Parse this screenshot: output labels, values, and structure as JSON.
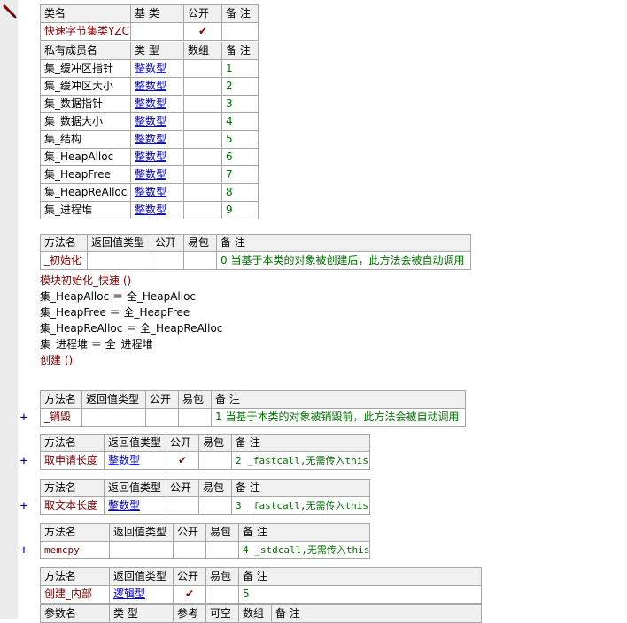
{
  "class_table": {
    "headers": [
      "类名",
      "基 类",
      "公开",
      "备 注"
    ],
    "name": "快速字节集类YZC",
    "base": "",
    "public": "✔",
    "note": ""
  },
  "members_table": {
    "headers": [
      "私有成员名",
      "类 型",
      "数组",
      "备 注"
    ],
    "rows": [
      {
        "name": "集_缓冲区指针",
        "type": "整数型",
        "array": "",
        "note": "1"
      },
      {
        "name": "集_缓冲区大小",
        "type": "整数型",
        "array": "",
        "note": "2"
      },
      {
        "name": "集_数据指针",
        "type": "整数型",
        "array": "",
        "note": "3"
      },
      {
        "name": "集_数据大小",
        "type": "整数型",
        "array": "",
        "note": "4"
      },
      {
        "name": "集_结构",
        "type": "整数型",
        "array": "",
        "note": "5"
      },
      {
        "name": "集_HeapAlloc",
        "type": "整数型",
        "array": "",
        "note": "6"
      },
      {
        "name": "集_HeapFree",
        "type": "整数型",
        "array": "",
        "note": "7"
      },
      {
        "name": "集_HeapReAlloc",
        "type": "整数型",
        "array": "",
        "note": "8"
      },
      {
        "name": "集_进程堆",
        "type": "整数型",
        "array": "",
        "note": "9"
      }
    ]
  },
  "method_headers": [
    "方法名",
    "返回值类型",
    "公开",
    "易包",
    "备 注"
  ],
  "methods": [
    {
      "name": "_初始化",
      "ret": "",
      "public": "",
      "easy": "",
      "note": "0 当基于本类的对象被创建后，此方法会被自动调用"
    },
    {
      "name": "_销毁",
      "ret": "",
      "public": "",
      "easy": "",
      "note": "1 当基于本类的对象被销毁前，此方法会被自动调用"
    },
    {
      "name": "取申请长度",
      "ret": "整数型",
      "public": "✔",
      "easy": "",
      "note": "2 _fastcall,无需传入this"
    },
    {
      "name": "取文本长度",
      "ret": "整数型",
      "public": "",
      "easy": "",
      "note": "3 _fastcall,无需传入this"
    },
    {
      "name": "memcpy",
      "ret": "",
      "public": "",
      "easy": "",
      "note": "4 _stdcall,无需传入this"
    },
    {
      "name": "创建_内部",
      "ret": "逻辑型",
      "public": "✔",
      "easy": "",
      "note": "5"
    }
  ],
  "code_lines": [
    "模块初始化_快速 ()",
    "集_HeapAlloc ＝ 全_HeapAlloc",
    "集_HeapFree ＝ 全_HeapFree",
    "集_HeapReAlloc ＝ 全_HeapReAlloc",
    "集_进程堆 ＝ 全_进程堆",
    "创建 ()"
  ],
  "param_headers": [
    "参数名",
    "类 型",
    "参考",
    "可空",
    "数组",
    "备 注"
  ],
  "expand_symbol": "+"
}
